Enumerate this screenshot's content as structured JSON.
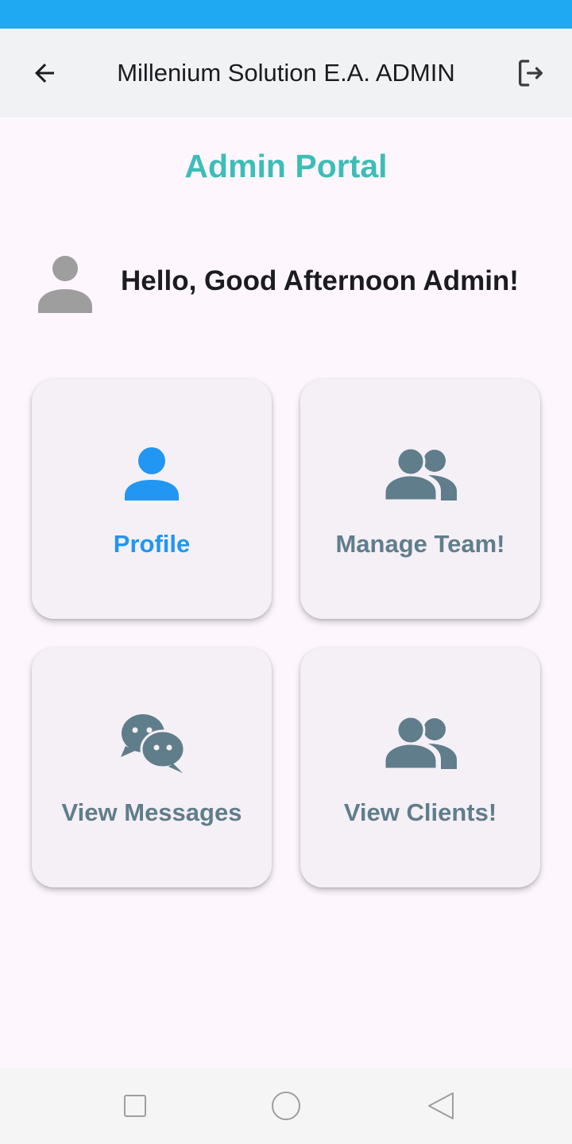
{
  "app_bar": {
    "title": "Millenium Solution E.A. ADMIN",
    "back_icon": "arrow-left-icon",
    "logout_icon": "logout-icon"
  },
  "portal_title": "Admin Portal",
  "greeting": "Hello, Good Afternoon Admin!",
  "colors": {
    "status_bar": "#1ea9f2",
    "accent_teal": "#3dbdb8",
    "active_blue": "#2196f3",
    "icon_slate": "#607d8b"
  },
  "cards": [
    {
      "label": "Profile",
      "icon": "person-icon",
      "color": "#2196f3"
    },
    {
      "label": "Manage Team!",
      "icon": "people-icon",
      "color": "#607d8b"
    },
    {
      "label": "View Messages",
      "icon": "chat-icon",
      "color": "#607d8b"
    },
    {
      "label": "View Clients!",
      "icon": "people-icon",
      "color": "#607d8b"
    }
  ],
  "system_nav": [
    "recents-button",
    "home-button",
    "back-nav-button"
  ]
}
